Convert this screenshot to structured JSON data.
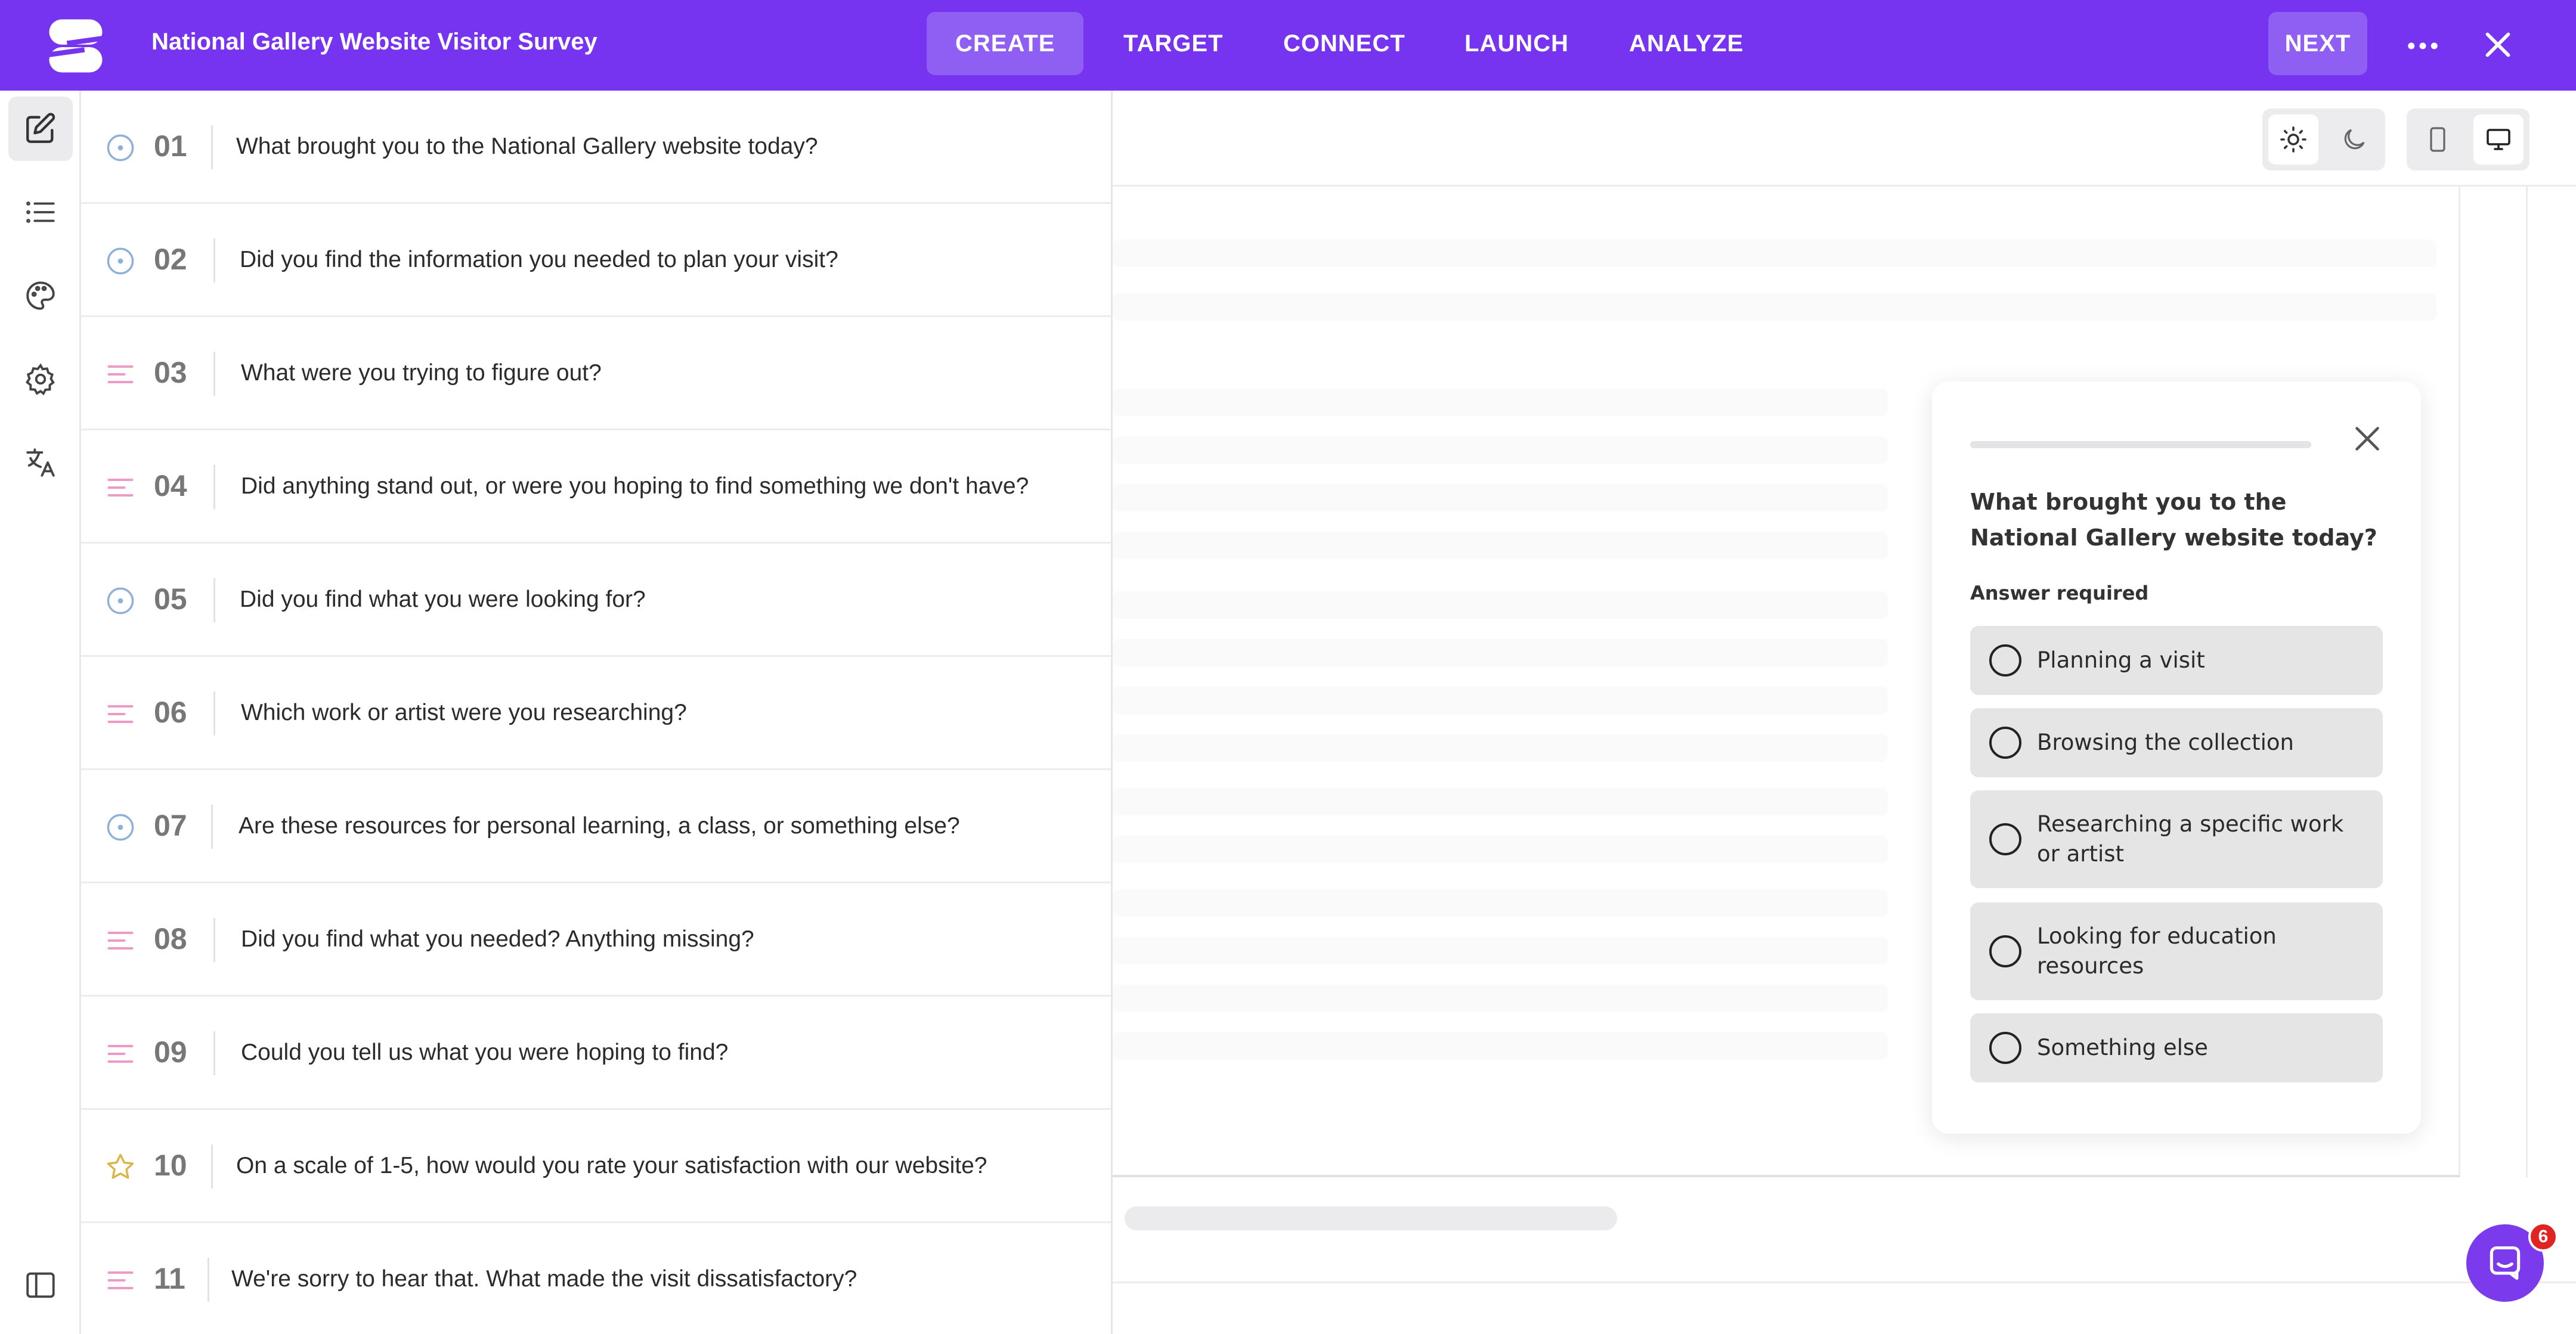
{
  "app": {
    "survey_title": "National Gallery Website Visitor Survey",
    "brand_color": "#7633f0",
    "accent_color": "#7c3aed"
  },
  "nav": {
    "tabs": [
      {
        "label": "CREATE",
        "active": true
      },
      {
        "label": "TARGET",
        "active": false
      },
      {
        "label": "CONNECT",
        "active": false
      },
      {
        "label": "LAUNCH",
        "active": false
      },
      {
        "label": "ANALYZE",
        "active": false
      }
    ],
    "next_label": "NEXT"
  },
  "rail": {
    "icons": [
      "edit-icon",
      "list-icon",
      "palette-icon",
      "settings-gear-icon",
      "translate-icon",
      "sidebar-toggle-icon"
    ],
    "active": "edit-icon"
  },
  "questions": [
    {
      "number": "01",
      "type": "single-choice",
      "text": "What brought you to the National Gallery website today?"
    },
    {
      "number": "02",
      "type": "single-choice",
      "text": "Did you find the information you needed to plan your visit?"
    },
    {
      "number": "03",
      "type": "open-text",
      "text": "What were you trying to figure out?"
    },
    {
      "number": "04",
      "type": "open-text",
      "text": "Did anything stand out, or were you hoping to find something we don't have?"
    },
    {
      "number": "05",
      "type": "single-choice",
      "text": "Did you find what you were looking for?"
    },
    {
      "number": "06",
      "type": "open-text",
      "text": "Which work or artist were you researching?"
    },
    {
      "number": "07",
      "type": "single-choice",
      "text": "Are these resources for personal learning, a class, or something else?"
    },
    {
      "number": "08",
      "type": "open-text",
      "text": "Did you find what you needed? Anything missing?"
    },
    {
      "number": "09",
      "type": "open-text",
      "text": "Could you tell us what you were hoping to find?"
    },
    {
      "number": "10",
      "type": "rating",
      "text": "On a scale of 1-5, how would you rate your satisfaction with our website?"
    },
    {
      "number": "11",
      "type": "open-text",
      "text": "We're sorry to hear that. What made the visit dissatisfactory?"
    }
  ],
  "preview": {
    "theme_options": [
      "light-mode-icon",
      "dark-mode-icon"
    ],
    "theme_selected": "light-mode-icon",
    "device_options": [
      "mobile-icon",
      "desktop-icon"
    ],
    "device_selected": "desktop-icon",
    "card": {
      "question": "What brought you to the National Gallery website today?",
      "required_label": "Answer required",
      "choices": [
        "Planning a visit",
        "Browsing the collection",
        "Researching a specific work or artist",
        "Looking for education resources",
        "Something else"
      ]
    }
  },
  "chat": {
    "unread_count": "6"
  }
}
